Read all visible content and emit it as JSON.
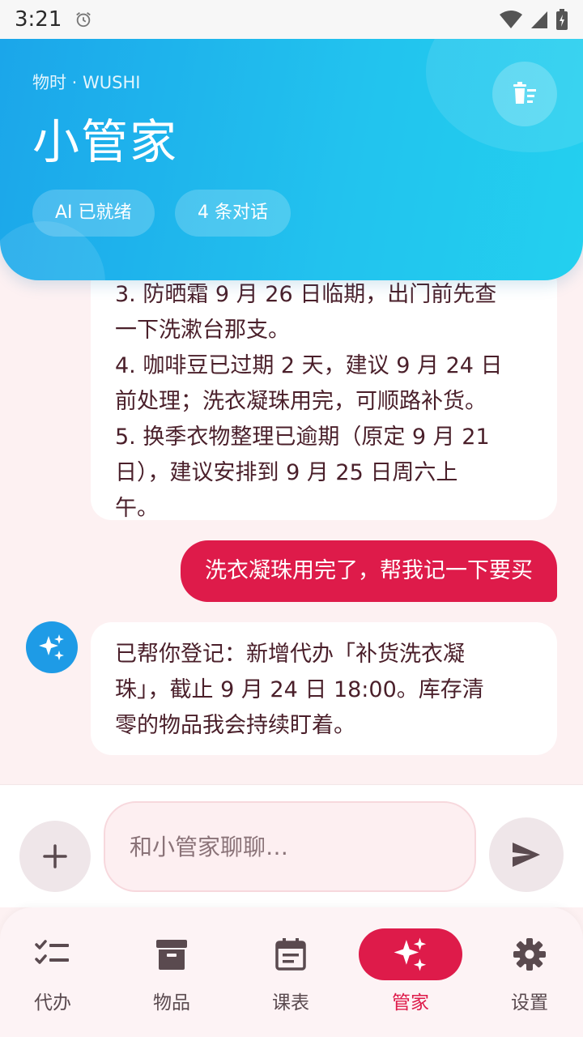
{
  "status_bar": {
    "time": "3:21"
  },
  "header": {
    "brand": "物时 · WUSHI",
    "title": "小管家",
    "chips": [
      "AI 已就绪",
      "4 条对话"
    ]
  },
  "messages": {
    "ai_1_lines": [
      "3. 防晒霜 9 月 26 日临期，出门前先查",
      "一下洗漱台那支。",
      "4. 咖啡豆已过期 2 天，建议 9 月 24 日",
      "前处理；洗衣凝珠用完，可顺路补货。",
      "5. 换季衣物整理已逾期（原定 9 月 21",
      "日），建议安排到 9 月 25 日周六上",
      "午。"
    ],
    "user_1": "洗衣凝珠用完了，帮我记一下要买",
    "ai_2_lines": [
      "已帮你登记：新增代办「补货洗衣凝",
      "珠」，截止 9 月 24 日 18:00。库存清",
      "零的物品我会持续盯着。"
    ]
  },
  "input": {
    "placeholder": "和小管家聊聊…"
  },
  "nav": {
    "items": [
      {
        "label": "代办",
        "icon": "checklist-icon"
      },
      {
        "label": "物品",
        "icon": "archive-box-icon"
      },
      {
        "label": "课表",
        "icon": "calendar-icon"
      },
      {
        "label": "管家",
        "icon": "sparkle-icon"
      },
      {
        "label": "设置",
        "icon": "gear-icon"
      }
    ],
    "active_index": 3
  },
  "colors": {
    "accent": "#de1b4a",
    "header_start": "#1ba6ea",
    "header_end": "#23d0ef",
    "avatar": "#1e9be6"
  }
}
